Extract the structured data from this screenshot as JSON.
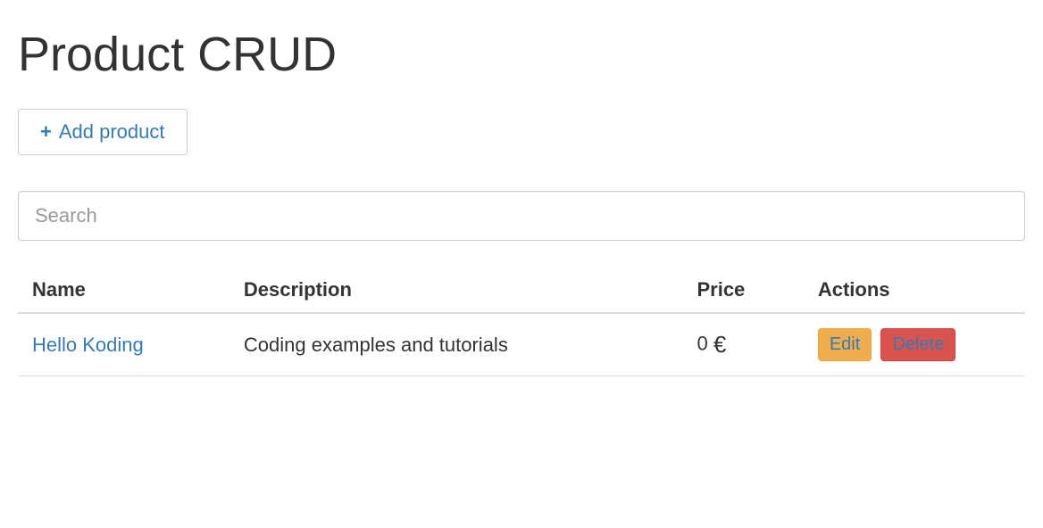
{
  "page": {
    "title": "Product CRUD"
  },
  "toolbar": {
    "add_label": "Add product"
  },
  "search": {
    "placeholder": "Search",
    "value": ""
  },
  "table": {
    "headers": {
      "name": "Name",
      "description": "Description",
      "price": "Price",
      "actions": "Actions"
    },
    "rows": [
      {
        "name": "Hello Koding",
        "description": "Coding examples and tutorials",
        "price": "0",
        "currency": "€"
      }
    ],
    "actions": {
      "edit": "Edit",
      "delete": "Delete"
    }
  }
}
